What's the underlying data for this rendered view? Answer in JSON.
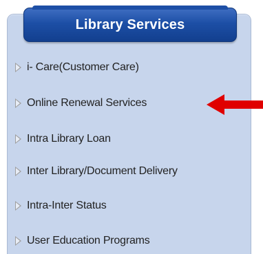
{
  "panel": {
    "title": "Library Services"
  },
  "menu": {
    "items": [
      {
        "label": "i- Care(Customer Care)"
      },
      {
        "label": "Online Renewal Services"
      },
      {
        "label": "Intra Library Loan"
      },
      {
        "label": "Inter Library/Document Delivery"
      },
      {
        "label": "Intra-Inter Status"
      },
      {
        "label": "User Education Programs"
      }
    ]
  },
  "colors": {
    "panel_background": "#c7d5ec",
    "header_blue": "#1d4fa6",
    "arrow_red": "#e00000",
    "bullet_gray": "#9f9f9f"
  },
  "icons": {
    "bullet": "triangle-right-icon",
    "pointer": "red-left-arrow-icon"
  }
}
